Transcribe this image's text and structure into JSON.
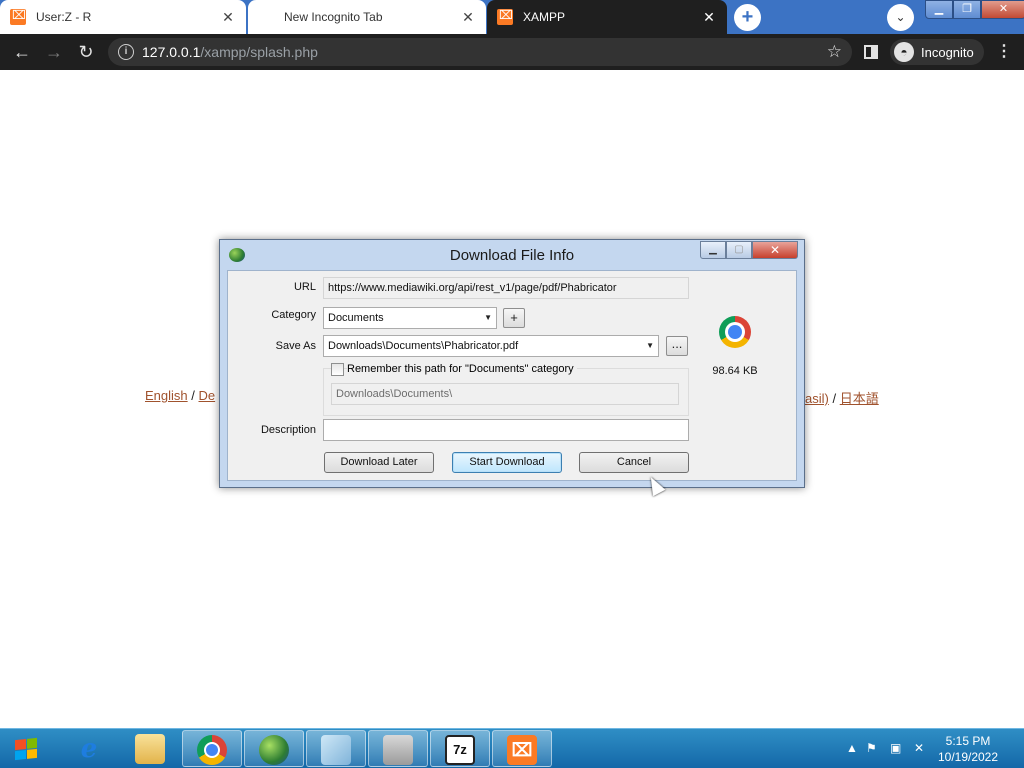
{
  "browser": {
    "tabs": [
      {
        "label": "User:Z - R",
        "state": "inactive"
      },
      {
        "label": "New Incognito Tab",
        "state": "inactive"
      },
      {
        "label": "XAMPP",
        "state": "active"
      }
    ],
    "url_host": "127.0.0.1",
    "url_path": "/xampp/splash.php",
    "profile_label": "Incognito"
  },
  "page": {
    "languages_left": [
      "English",
      "De"
    ],
    "languages_right": [
      "asil)",
      "日本語"
    ],
    "separator": "/"
  },
  "dialog": {
    "title": "Download File Info",
    "url_label": "URL",
    "url_value": "https://www.mediawiki.org/api/rest_v1/page/pdf/Phabricator",
    "category_label": "Category",
    "category_value": "Documents",
    "add_category_label": "+",
    "save_as_label": "Save As",
    "save_as_value": "Downloads\\Documents\\Phabricator.pdf",
    "browse_label": "...",
    "remember_label": "Remember this path for \"Documents\" category",
    "remember_checked": false,
    "remember_path": "Downloads\\Documents\\",
    "description_label": "Description",
    "description_value": "",
    "file_size": "98.64 KB",
    "buttons": {
      "download_later": "Download Later",
      "start_download": "Start Download",
      "cancel": "Cancel"
    }
  },
  "taskbar": {
    "time": "5:15 PM",
    "date": "10/19/2022",
    "zip_label": "7z"
  }
}
